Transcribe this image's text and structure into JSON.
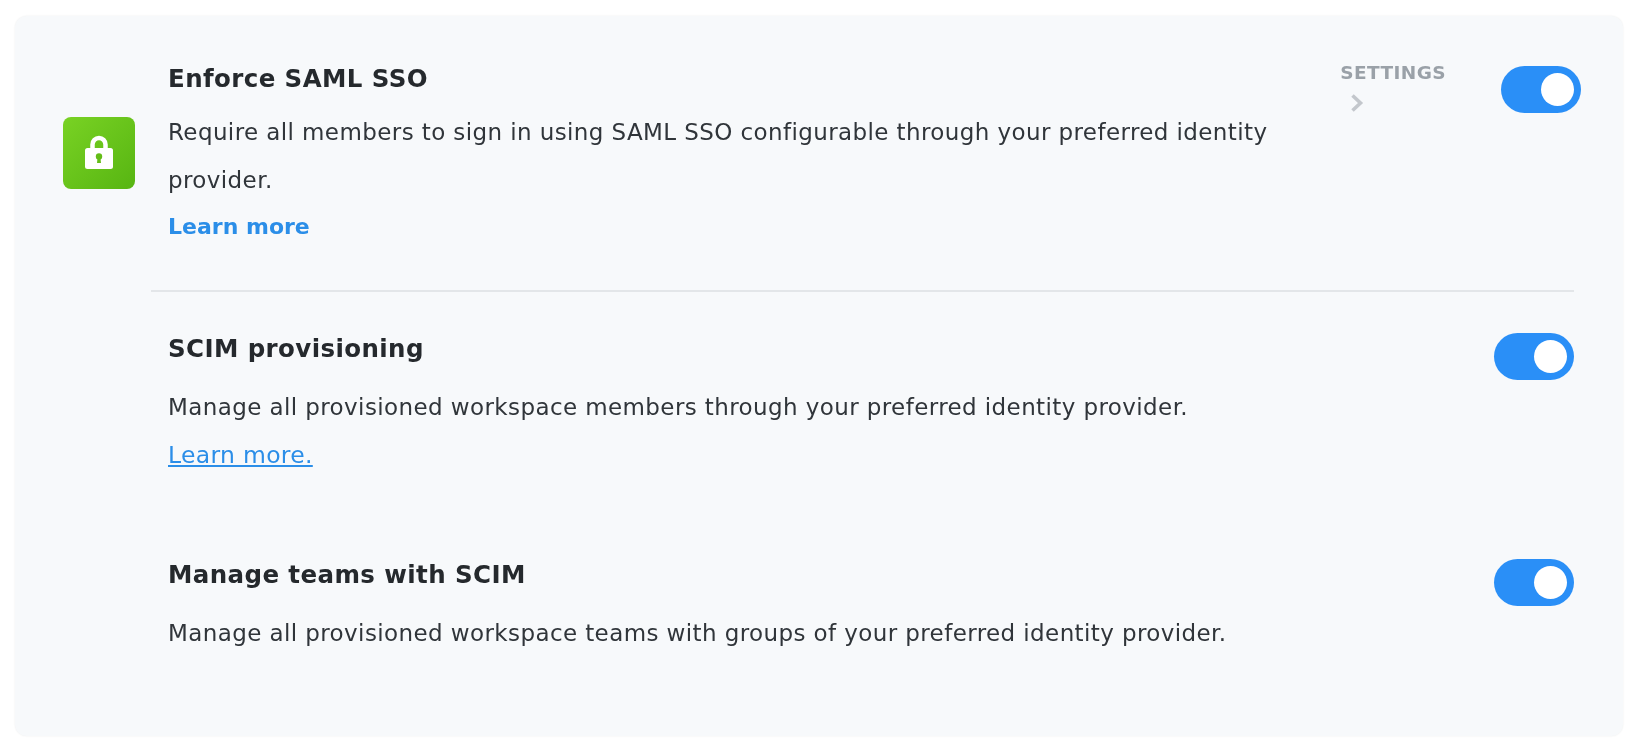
{
  "policies": [
    {
      "kind": "main",
      "title": "Enforce SAML SSO",
      "description": "Require all members to sign in using SAML SSO configurable through your preferred identity provider.",
      "link": "Learn more",
      "settings_link": "SETTINGS",
      "on": true
    },
    {
      "kind": "sub",
      "title": "SCIM provisioning",
      "description": "Manage all provisioned workspace members through your preferred identity provider.",
      "link": "Learn more.",
      "on": true
    },
    {
      "kind": "sub",
      "title": "Manage teams with SCIM",
      "description": "Manage all provisioned workspace teams with groups of your preferred identity provider.",
      "on": true
    }
  ]
}
